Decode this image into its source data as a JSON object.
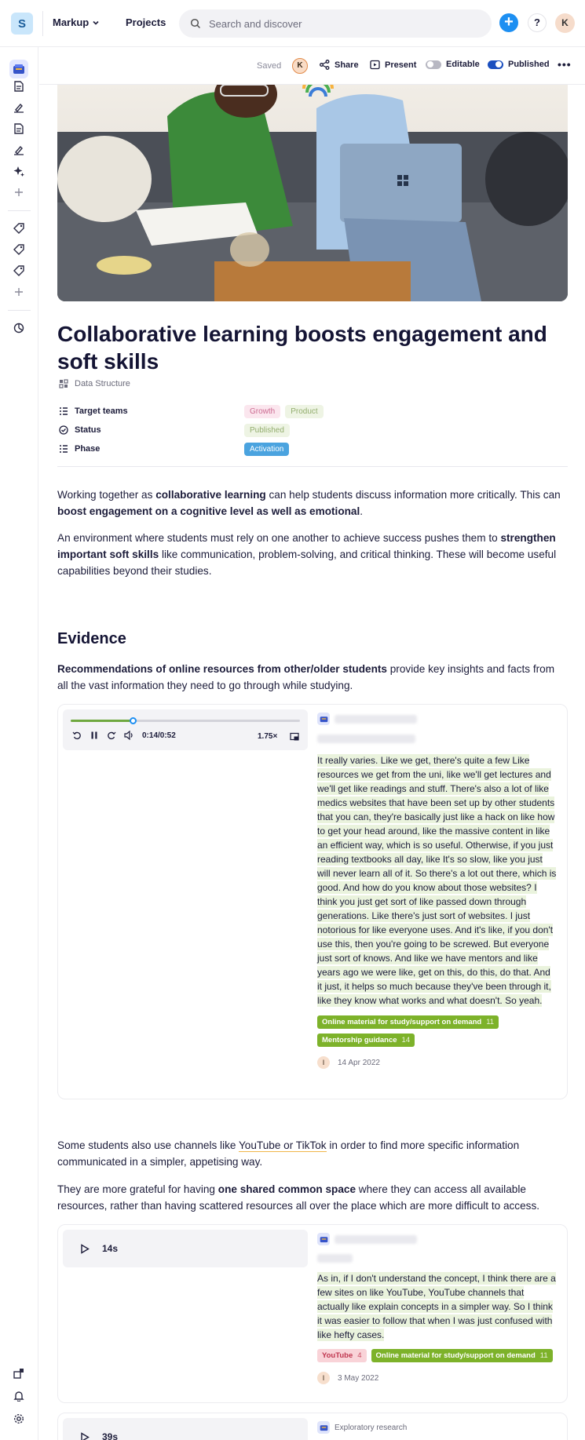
{
  "topbar": {
    "logo_letter": "S",
    "workspace": "Markup",
    "projects": "Projects",
    "search_placeholder": "Search and discover",
    "add": "+",
    "help": "?",
    "avatar": "K"
  },
  "actionbar": {
    "saved": "Saved",
    "avatar": "K",
    "share": "Share",
    "present": "Present",
    "editable": "Editable",
    "editable_on": false,
    "published": "Published",
    "published_on": true
  },
  "page": {
    "title": "Collaborative learning boosts engagement and soft skills",
    "doc_type": "Data Structure",
    "props": {
      "target_teams_label": "Target teams",
      "target_teams": [
        "Growth",
        "Product"
      ],
      "status_label": "Status",
      "status": "Published",
      "phase_label": "Phase",
      "phase": "Activation"
    },
    "intro": {
      "p1_a": "Working together as ",
      "p1_b": "collaborative learning",
      "p1_c": " can help students discuss information more critically. This can ",
      "p1_d": "boost engagement on a cognitive level as well as emotional",
      "p1_e": ".",
      "p2_a": "An environment where students must rely on one another to achieve success pushes them to ",
      "p2_b": "strengthen important soft skills",
      "p2_c": " like communication, problem-solving, and critical thinking. These will become useful capabilities beyond their studies."
    },
    "evidence_heading": "Evidence",
    "evidence_intro_a": "Recommendations of online resources from other/older students",
    "evidence_intro_b": " provide key insights and facts from all the vast information they need to go through while studying.",
    "mid": {
      "p1_a": "Some students also use channels like ",
      "p1_b": "YouTube or TikTok",
      "p1_c": " in order to find more specific information communicated in a simpler, appetising way.",
      "p2_a": "They are more grateful for having ",
      "p2_b": "one shared common space",
      "p2_c": " where they can access all available resources, rather than having scattered resources all over the place which are more difficult to access."
    }
  },
  "cards": [
    {
      "player_time": "0:14/0:52",
      "player_speed": "1.75×",
      "progress": 0.27,
      "quote": "It really varies. Like we get, there's quite a few Like resources we get from the uni, like we'll get lectures and we'll get like readings and stuff. There's also a lot of like medics websites that have been set up by other students that you can, they're basically just like a hack on like how to get your head around, like the massive content in like an efficient way, which is so useful. Otherwise, if you just reading textbooks all day, like It's so slow, like you just will never learn all of it. So there's a lot out there, which is good. And how do you know about those websites? I think you just get sort of like passed down through generations. Like there's just sort of websites. I just notorious for like everyone uses. And it's like, if you don't use this, then you're going to be screwed. But everyone just sort of knows. And like we have mentors and like years ago we were like, get on this, do this, do that. And it just, it helps so much because they've been through it, like they know what works and what doesn't. So yeah.",
      "tags": [
        {
          "label": "Online material for study/support on demand",
          "count": "11",
          "color": "#7db22a"
        },
        {
          "label": "Mentorship guidance",
          "count": "14",
          "color": "#7db22a"
        }
      ],
      "author": "I",
      "date": "14 Apr 2022"
    },
    {
      "duration": "14s",
      "quote": "As in, if I don't understand the concept, I think there are a few sites on like YouTube, YouTube channels that actually like explain concepts in a simpler way. So I think it was easier to follow that when I was just confused with like hefty cases.",
      "tags": [
        {
          "label": "YouTube",
          "count": "4",
          "color": "#f9d3d8",
          "text": "#c0364f"
        },
        {
          "label": "Online material for study/support on demand",
          "count": "11",
          "color": "#7db22a"
        }
      ],
      "author": "I",
      "date": "3 May 2022"
    },
    {
      "duration": "39s",
      "source": "Exploratory research"
    }
  ]
}
